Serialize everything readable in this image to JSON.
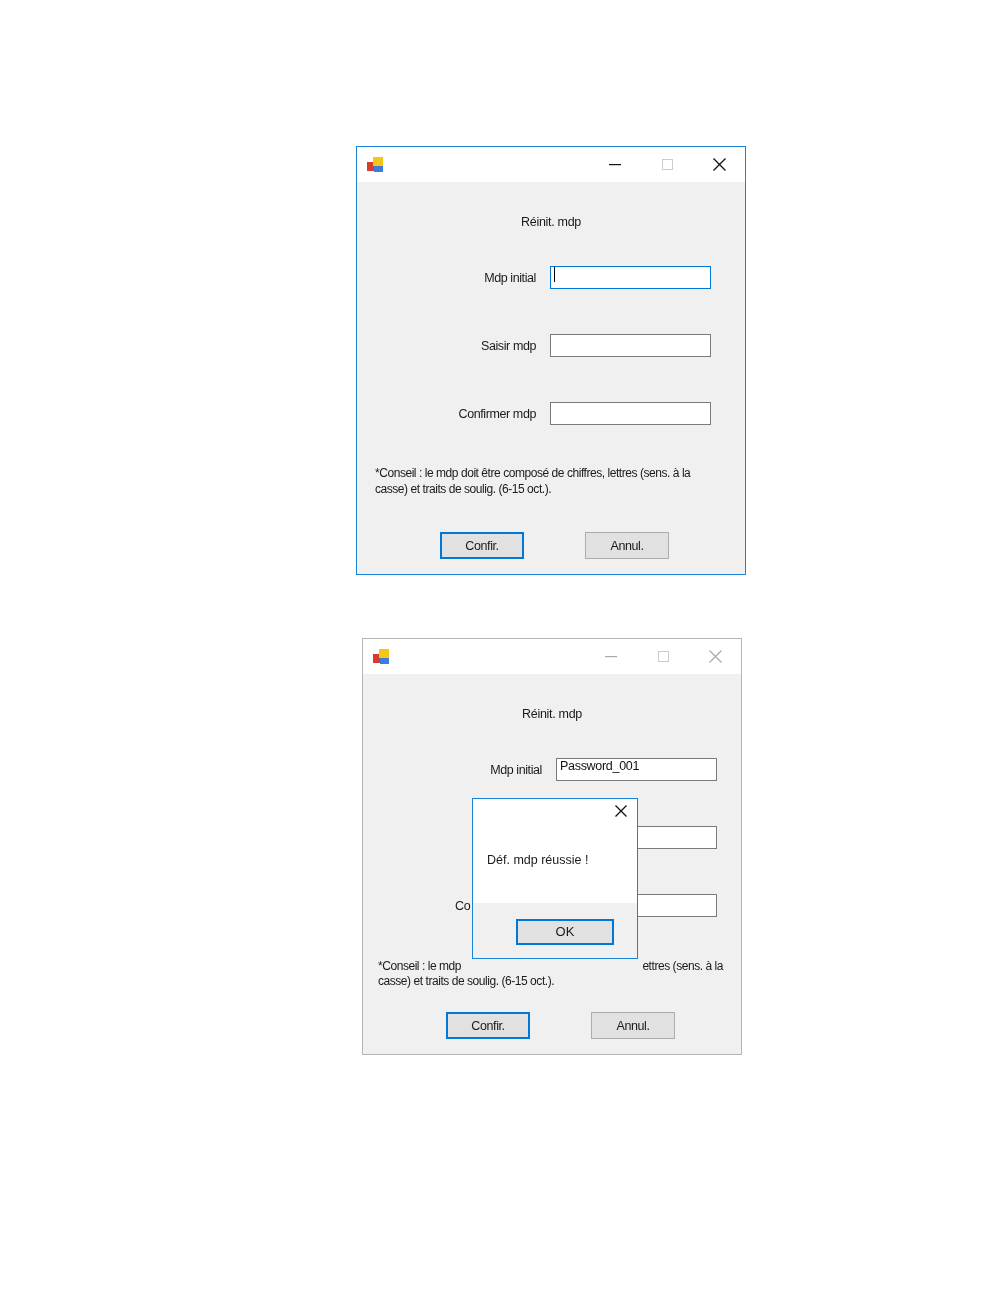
{
  "windows": [
    {
      "active": true,
      "title": "Réinit. mdp",
      "fields": [
        {
          "label": "Mdp initial",
          "focused": true
        },
        {
          "label": "Saisir mdp",
          "focused": false
        },
        {
          "label": "Confirmer mdp",
          "focused": false
        }
      ],
      "hint": "*Conseil : le mdp doit être composé de chiffres, lettres (sens. à la casse) et traits de soulig. (6-15 oct.).",
      "buttons": [
        {
          "label": "Confir.",
          "default": true
        },
        {
          "label": "Annul.",
          "default": false
        }
      ]
    },
    {
      "active": false,
      "title": "Réinit. mdp",
      "fields": [
        {
          "label": "Mdp initial",
          "value": "Password_001",
          "focused": false
        },
        {
          "focused": false
        },
        {
          "label": "Co",
          "focused": false
        }
      ],
      "hint_lines": [
        [
          "*Conseil : le mdp",
          "ettres (sens. à la"
        ],
        [
          "casse) et traits de soulig. (6-15 oct.)."
        ]
      ],
      "buttons": [
        {
          "label": "Confir.",
          "default": true
        },
        {
          "label": "Annul.",
          "default": false
        }
      ],
      "message_box": {
        "message": "Déf. mdp réussie !",
        "button": "OK"
      }
    }
  ]
}
